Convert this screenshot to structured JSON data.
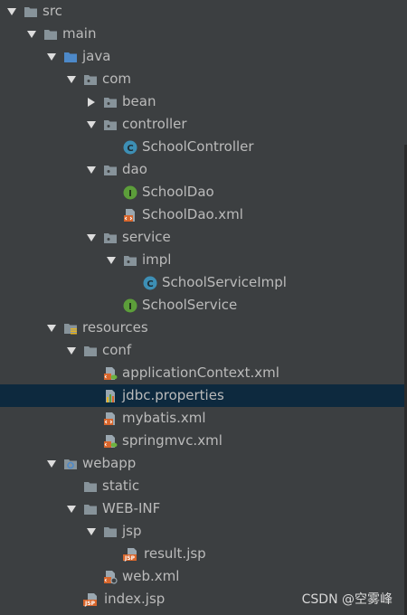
{
  "tree": [
    {
      "label": "src",
      "arrow": "down",
      "icon": "folder-icon"
    },
    {
      "label": "main",
      "arrow": "down",
      "icon": "folder-icon"
    },
    {
      "label": "java",
      "arrow": "down",
      "icon": "source-folder-icon"
    },
    {
      "label": "com",
      "arrow": "down",
      "icon": "package-icon"
    },
    {
      "label": "bean",
      "arrow": "right",
      "icon": "package-icon"
    },
    {
      "label": "controller",
      "arrow": "down",
      "icon": "package-icon"
    },
    {
      "label": "SchoolController",
      "arrow": "",
      "icon": "class-icon",
      "badge": "C"
    },
    {
      "label": "dao",
      "arrow": "down",
      "icon": "package-icon"
    },
    {
      "label": "SchoolDao",
      "arrow": "",
      "icon": "interface-icon",
      "badge": "I"
    },
    {
      "label": "SchoolDao.xml",
      "arrow": "",
      "icon": "xml-file-icon"
    },
    {
      "label": "service",
      "arrow": "down",
      "icon": "package-icon"
    },
    {
      "label": "impl",
      "arrow": "down",
      "icon": "package-icon"
    },
    {
      "label": "SchoolServiceImpl",
      "arrow": "",
      "icon": "class-icon",
      "badge": "C"
    },
    {
      "label": "SchoolService",
      "arrow": "",
      "icon": "interface-icon",
      "badge": "I"
    },
    {
      "label": "resources",
      "arrow": "down",
      "icon": "resources-folder-icon"
    },
    {
      "label": "conf",
      "arrow": "down",
      "icon": "folder-icon"
    },
    {
      "label": "applicationContext.xml",
      "arrow": "",
      "icon": "spring-xml-icon"
    },
    {
      "label": "jdbc.properties",
      "arrow": "",
      "icon": "properties-file-icon",
      "selected": true
    },
    {
      "label": "mybatis.xml",
      "arrow": "",
      "icon": "xml-file-icon"
    },
    {
      "label": "springmvc.xml",
      "arrow": "",
      "icon": "spring-xml-icon"
    },
    {
      "label": "webapp",
      "arrow": "down",
      "icon": "web-folder-icon"
    },
    {
      "label": "static",
      "arrow": "",
      "icon": "folder-icon"
    },
    {
      "label": "WEB-INF",
      "arrow": "down",
      "icon": "folder-icon"
    },
    {
      "label": "jsp",
      "arrow": "down",
      "icon": "folder-icon"
    },
    {
      "label": "result.jsp",
      "arrow": "",
      "icon": "jsp-file-icon",
      "badge": "JSP"
    },
    {
      "label": "web.xml",
      "arrow": "",
      "icon": "web-xml-icon"
    },
    {
      "label": "index.jsp",
      "arrow": "",
      "icon": "jsp-file-icon",
      "badge": "JSP"
    }
  ],
  "watermark": "CSDN @空雾峰",
  "colors": {
    "background": "#3c3f41",
    "selection": "#0d293e",
    "text": "#bbbbbb",
    "folder": "#87939a",
    "source_folder": "#4d89c9",
    "class_badge": "#3d8fb5",
    "interface_badge": "#5c9e3a",
    "xml_file": "#d8662c"
  }
}
